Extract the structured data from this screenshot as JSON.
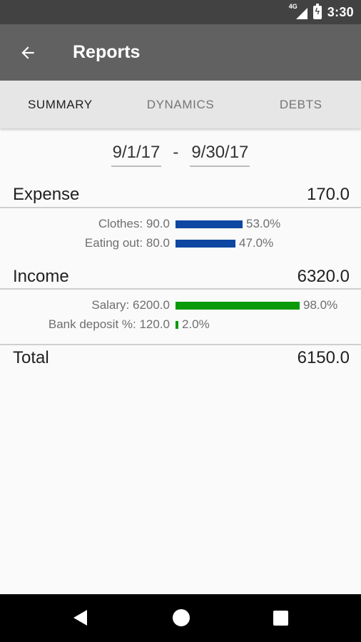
{
  "status": {
    "network": "4G",
    "time": "3:30",
    "battery_icon": "battery-charging-icon"
  },
  "app_bar": {
    "title": "Reports",
    "back_icon": "arrow-left-icon"
  },
  "tabs": [
    {
      "label": "SUMMARY"
    },
    {
      "label": "DYNAMICS"
    },
    {
      "label": "DEBTS"
    }
  ],
  "period": {
    "start": "9/1/17",
    "separator": "-",
    "end": "9/30/17"
  },
  "expense": {
    "label": "Expense",
    "total": "170.0",
    "color": "#0d47a1",
    "items": [
      {
        "label": "Clothes: 90.0",
        "percent_text": "53.0%",
        "share": 0.53
      },
      {
        "label": "Eating out: 80.0",
        "percent_text": "47.0%",
        "share": 0.47
      }
    ]
  },
  "income": {
    "label": "Income",
    "total": "6320.0",
    "color": "#0a9a0a",
    "items": [
      {
        "label": "Salary: 6200.0",
        "percent_text": "98.0%",
        "share": 0.98
      },
      {
        "label": "Bank deposit %: 120.0",
        "percent_text": "2.0%",
        "share": 0.02
      }
    ]
  },
  "total": {
    "label": "Total",
    "value": "6150.0"
  },
  "nav": {
    "back_icon": "triangle-back-icon",
    "home_icon": "circle-home-icon",
    "recents_icon": "square-recents-icon"
  }
}
